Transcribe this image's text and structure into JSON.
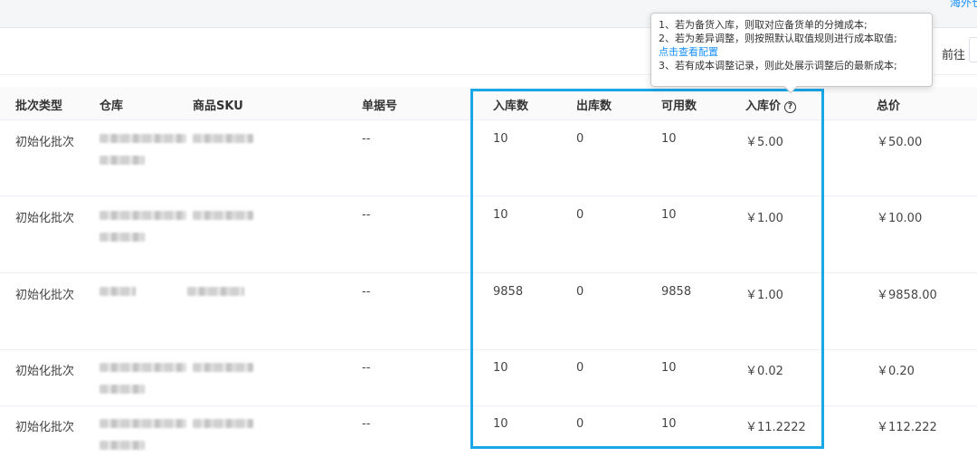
{
  "top": {
    "link_text": "海外仓"
  },
  "pagination": {
    "goto_label": "前往"
  },
  "tooltip": {
    "line1": "1、若为备货入库，则取对应备货单的分摊成本;",
    "line2": "2、若为差异调整，则按照默认取值规则进行成本取值;",
    "link": "点击查看配置",
    "line3": "3、若有成本调整记录，则此处展示调整后的最新成本;"
  },
  "table": {
    "headers": {
      "batch_type": "批次类型",
      "warehouse": "仓库",
      "sku": "商品SKU",
      "doc_no": "单据号",
      "in_qty": "入库数",
      "out_qty": "出库数",
      "available": "可用数",
      "in_price": "入库价",
      "total": "总价"
    },
    "rows": [
      {
        "batch_type": "初始化批次",
        "doc_no": "--",
        "in_qty": "10",
        "out_qty": "0",
        "available": "10",
        "in_price": "￥5.00",
        "total": "￥50.00"
      },
      {
        "batch_type": "初始化批次",
        "doc_no": "--",
        "in_qty": "10",
        "out_qty": "0",
        "available": "10",
        "in_price": "￥1.00",
        "total": "￥10.00"
      },
      {
        "batch_type": "初始化批次",
        "doc_no": "--",
        "in_qty": "9858",
        "out_qty": "0",
        "available": "9858",
        "in_price": "￥1.00",
        "total": "￥9858.00"
      },
      {
        "batch_type": "初始化批次",
        "doc_no": "--",
        "in_qty": "10",
        "out_qty": "0",
        "available": "10",
        "in_price": "￥0.02",
        "total": "￥0.20"
      },
      {
        "batch_type": "初始化批次",
        "doc_no": "--",
        "in_qty": "10",
        "out_qty": "0",
        "available": "10",
        "in_price": "￥11.2222",
        "total": "￥112.222"
      }
    ]
  },
  "colors": {
    "highlight": "#19a7e8",
    "link": "#1890ff"
  }
}
